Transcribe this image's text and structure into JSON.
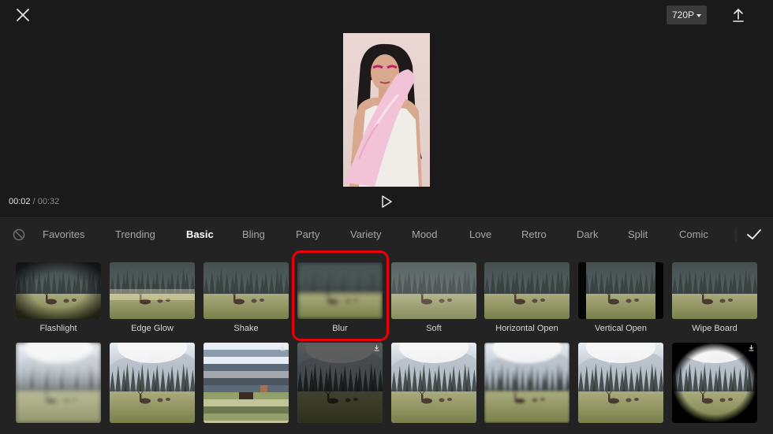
{
  "header": {
    "close_icon": "close-icon",
    "resolution": "720P",
    "resolution_icon": "caret-down-icon",
    "export_icon": "upload-icon"
  },
  "preview": {
    "current_time": "00:02",
    "separator": "/",
    "total_time": "00:32",
    "play_icon": "play-icon"
  },
  "effects": {
    "none_icon": "ban-icon",
    "confirm_icon": "checkmark-icon",
    "active_tab": "Basic",
    "tabs": [
      {
        "label": "Favorites"
      },
      {
        "label": "Trending"
      },
      {
        "label": "Basic"
      },
      {
        "label": "Bling"
      },
      {
        "label": "Party"
      },
      {
        "label": "Variety"
      },
      {
        "label": "Mood"
      },
      {
        "label": "Love"
      },
      {
        "label": "Retro"
      },
      {
        "label": "Dark"
      },
      {
        "label": "Split"
      },
      {
        "label": "Comic"
      }
    ],
    "row1": [
      {
        "label": "Flashlight",
        "style": "flashlight"
      },
      {
        "label": "Edge Glow",
        "style": "glow"
      },
      {
        "label": "Shake",
        "style": "normal"
      },
      {
        "label": "Blur",
        "style": "blur",
        "selected": true
      },
      {
        "label": "Soft",
        "style": "soft"
      },
      {
        "label": "Horizontal Open",
        "style": "normal"
      },
      {
        "label": "Vertical Open",
        "style": "vopen"
      },
      {
        "label": "Wipe Board",
        "style": "normal"
      }
    ],
    "row2": [
      {
        "style": "foggy",
        "icon": "download-icon"
      },
      {
        "style": "forest",
        "icon": "download-icon"
      },
      {
        "style": "pixel",
        "icon": "download-icon"
      },
      {
        "style": "dark",
        "icon": "download-icon"
      },
      {
        "style": "forest",
        "icon": "download-icon"
      },
      {
        "style": "forestblur",
        "icon": "download-icon"
      },
      {
        "style": "forest",
        "icon": "download-icon"
      },
      {
        "style": "vignette",
        "icon": "download-icon"
      }
    ]
  }
}
